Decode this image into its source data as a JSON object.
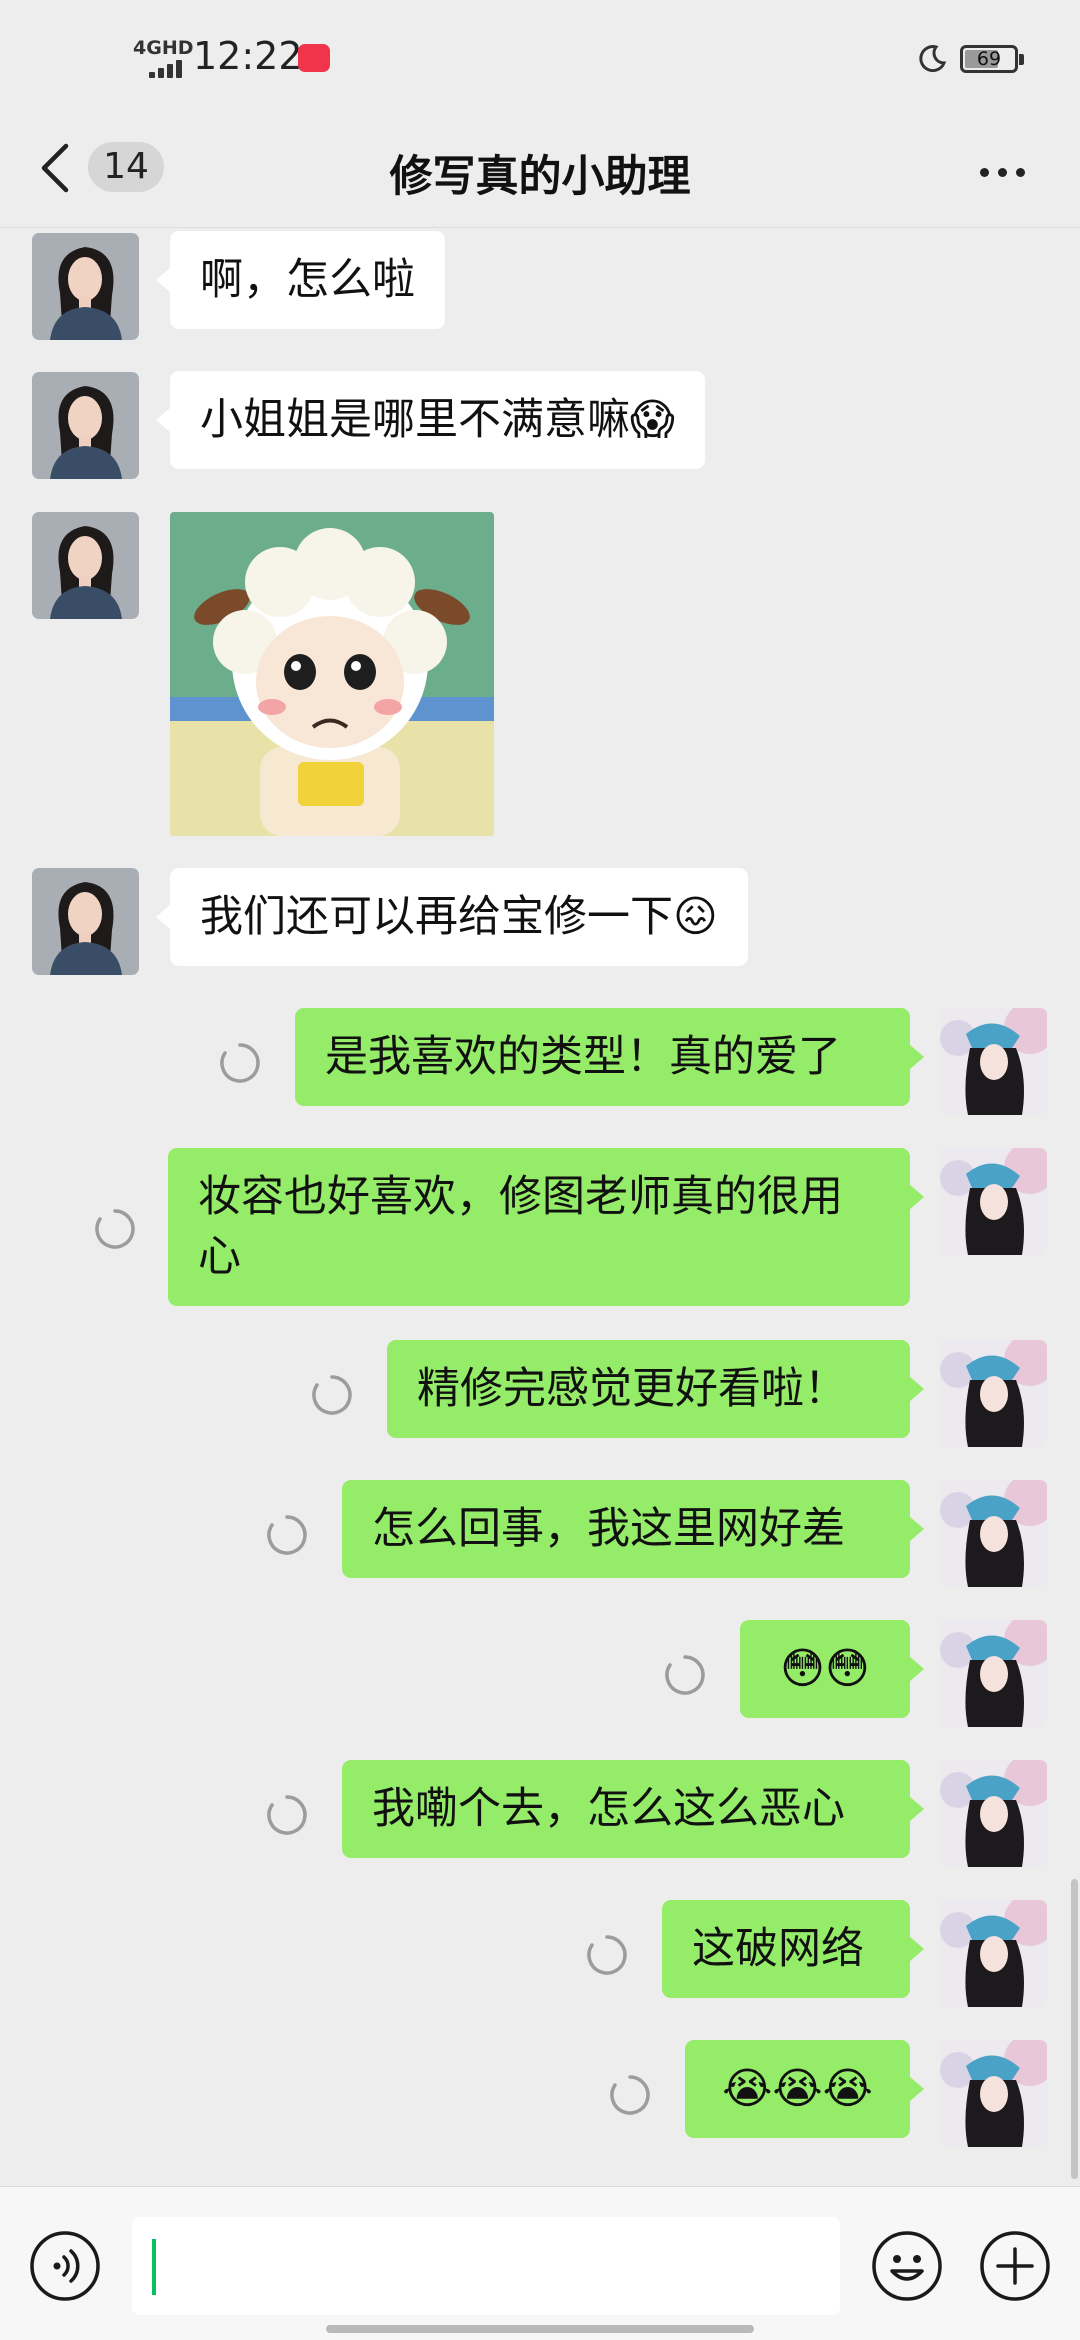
{
  "status_bar": {
    "network": "4GHD",
    "time": "12:22",
    "app_badge_color": "#f0344a",
    "battery_level": 69,
    "icons": [
      "signal-icon",
      "app-notification-icon",
      "do-not-disturb-moon-icon",
      "battery-icon"
    ]
  },
  "nav": {
    "back_icon": "chevron-left-icon",
    "unread_count": "14",
    "title": "修写真的小助理",
    "more_icon": "more-dots-icon"
  },
  "colors": {
    "outgoing_bubble": "#95ec69",
    "incoming_bubble": "#ffffff",
    "background": "#ededed",
    "accent": "#07c160"
  },
  "messages": [
    {
      "from": "agent",
      "type": "text",
      "text": "啊，怎么啦"
    },
    {
      "from": "agent",
      "type": "text",
      "text": "小姐姐是哪里不满意嘛😱"
    },
    {
      "from": "agent",
      "type": "sticker",
      "text": ""
    },
    {
      "from": "agent",
      "type": "text",
      "text": "我们还可以再给宝修一下😖"
    },
    {
      "from": "me",
      "type": "text",
      "text": "是我喜欢的类型！真的爱了",
      "status": "sending"
    },
    {
      "from": "me",
      "type": "text",
      "text": "妆容也好喜欢，修图老师真的很用心",
      "status": "sending"
    },
    {
      "from": "me",
      "type": "text",
      "text": "精修完感觉更好看啦！",
      "status": "sending"
    },
    {
      "from": "me",
      "type": "text",
      "text": "怎么回事，我这里网好差",
      "status": "sending"
    },
    {
      "from": "me",
      "type": "text",
      "text": "😳😳",
      "status": "sending"
    },
    {
      "from": "me",
      "type": "text",
      "text": "我嘞个去，怎么这么恶心",
      "status": "sending"
    },
    {
      "from": "me",
      "type": "text",
      "text": "这破网络",
      "status": "sending"
    },
    {
      "from": "me",
      "type": "text",
      "text": "😭😭😭",
      "status": "sending"
    }
  ],
  "input_bar": {
    "voice_icon": "voice-input-icon",
    "text_value": "",
    "emoji_icon": "emoji-smiley-icon",
    "plus_icon": "plus-icon"
  }
}
